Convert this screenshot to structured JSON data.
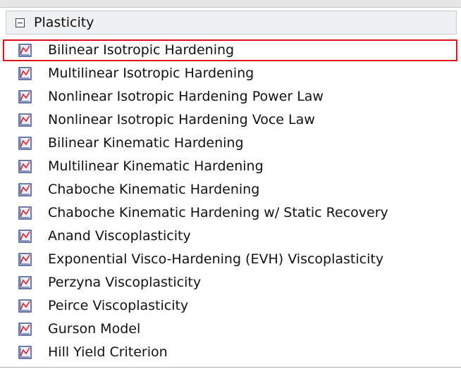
{
  "panel": {
    "section_title": "Plasticity",
    "collapse_symbol": "minus",
    "selected_index": 0,
    "selection_color": "#e0101a",
    "icon_name": "material-curve-icon",
    "items": [
      {
        "label": "Bilinear Isotropic Hardening"
      },
      {
        "label": "Multilinear Isotropic Hardening"
      },
      {
        "label": "Nonlinear Isotropic Hardening Power Law"
      },
      {
        "label": "Nonlinear Isotropic Hardening Voce Law"
      },
      {
        "label": "Bilinear Kinematic Hardening"
      },
      {
        "label": "Multilinear Kinematic Hardening"
      },
      {
        "label": "Chaboche Kinematic Hardening"
      },
      {
        "label": "Chaboche Kinematic Hardening w/ Static Recovery"
      },
      {
        "label": "Anand Viscoplasticity"
      },
      {
        "label": "Exponential Visco-Hardening (EVH) Viscoplasticity"
      },
      {
        "label": "Perzyna Viscoplasticity"
      },
      {
        "label": "Peirce Viscoplasticity"
      },
      {
        "label": "Gurson Model"
      },
      {
        "label": "Hill Yield Criterion"
      }
    ]
  }
}
